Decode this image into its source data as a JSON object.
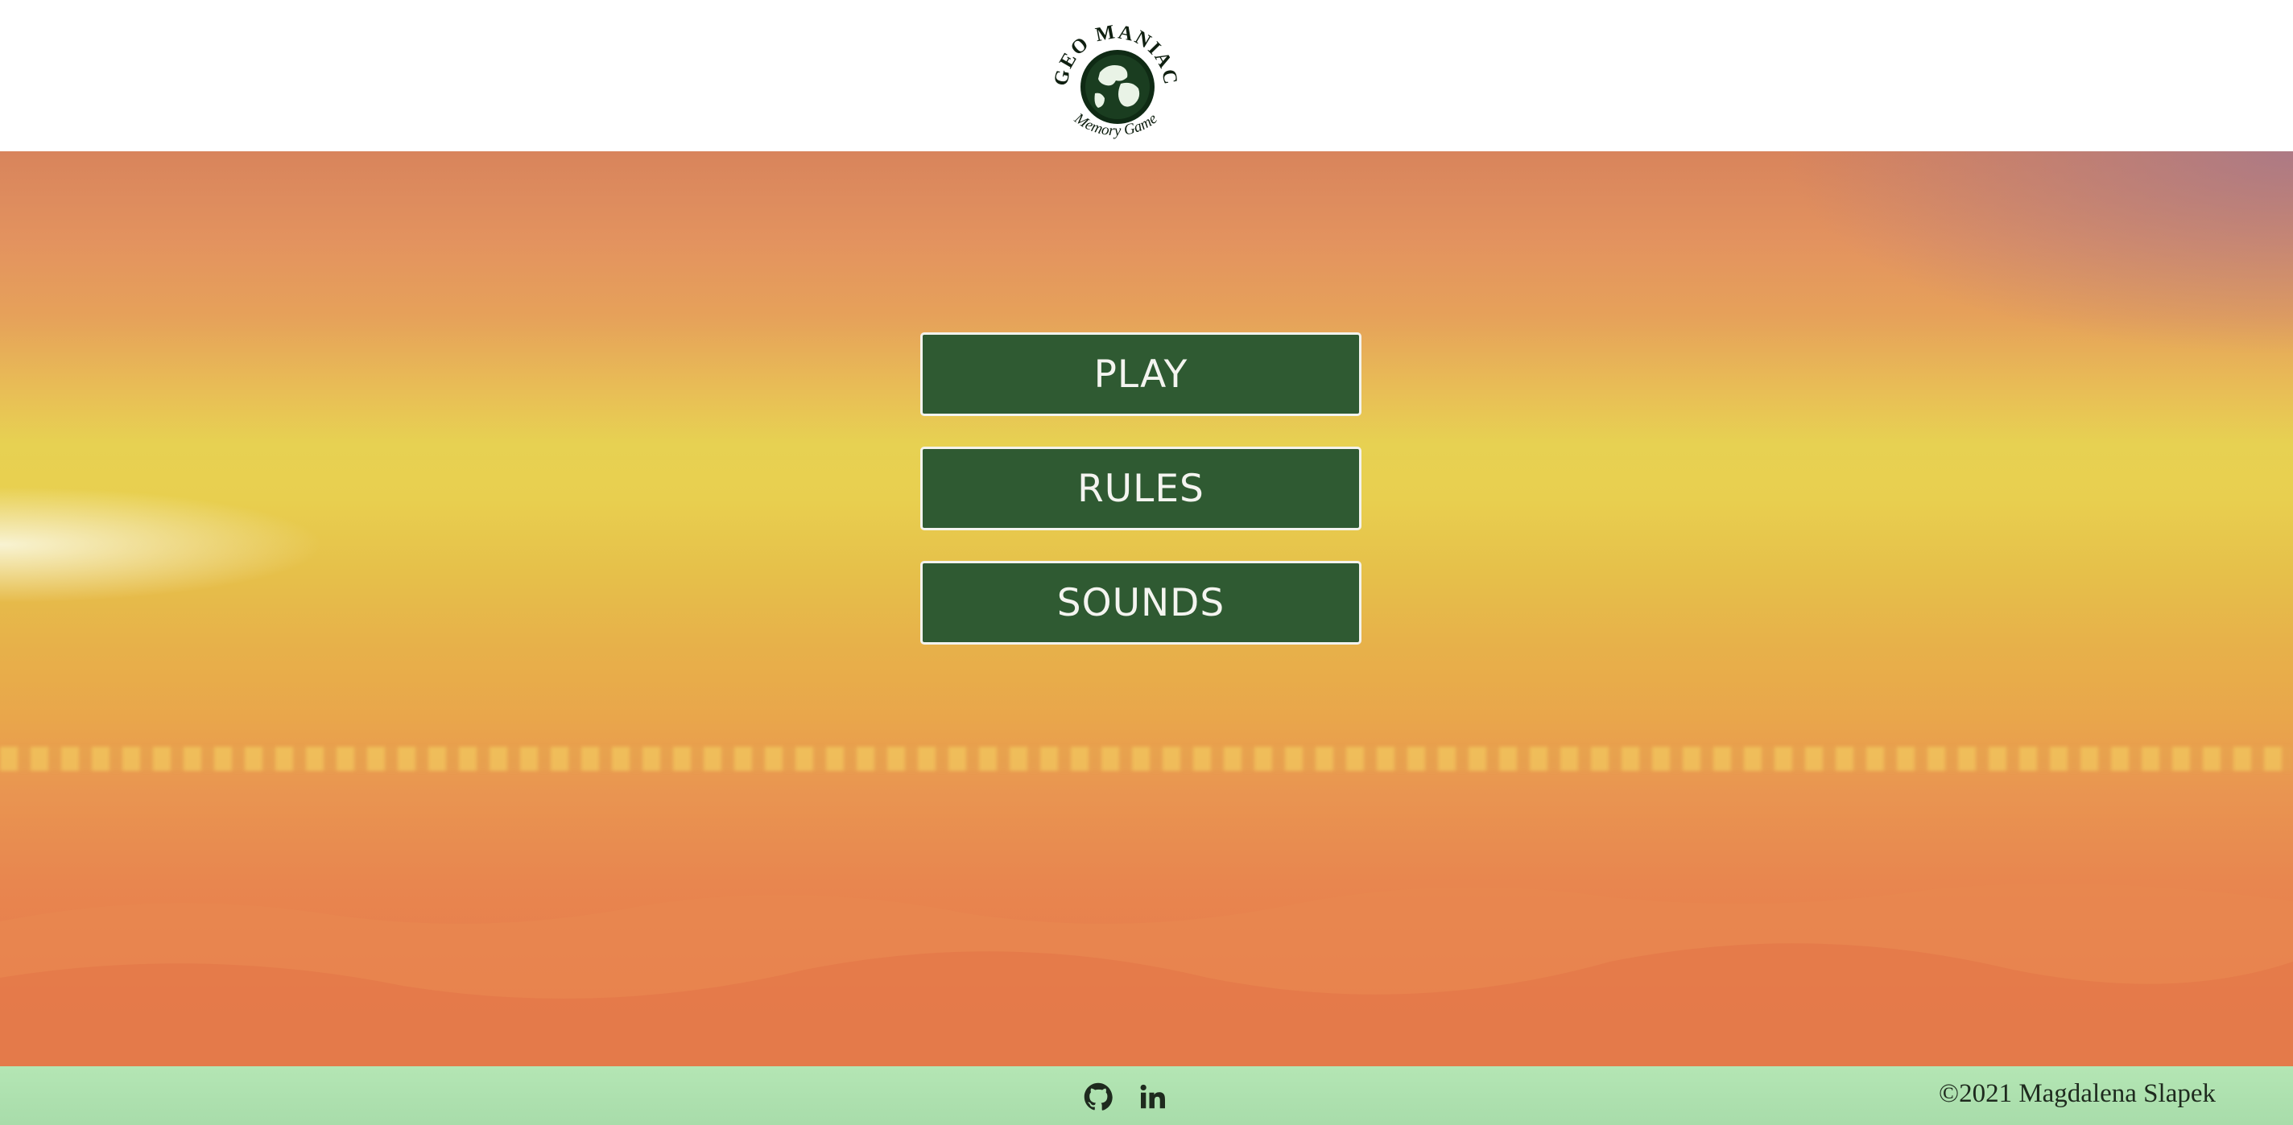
{
  "header": {
    "logo": {
      "top_text": "GEO MANIAC",
      "bottom_text": "Memory Game",
      "icon": "globe-icon"
    }
  },
  "menu": {
    "play_label": "PLAY",
    "rules_label": "RULES",
    "sounds_label": "SOUNDS"
  },
  "footer": {
    "github_icon": "github-icon",
    "linkedin_icon": "linkedin-icon",
    "copyright": "©2021 Magdalena Slapek"
  },
  "colors": {
    "button_bg": "#2f5a32",
    "button_border": "#f3f3ee",
    "footer_bg": "#b4e6b4"
  }
}
